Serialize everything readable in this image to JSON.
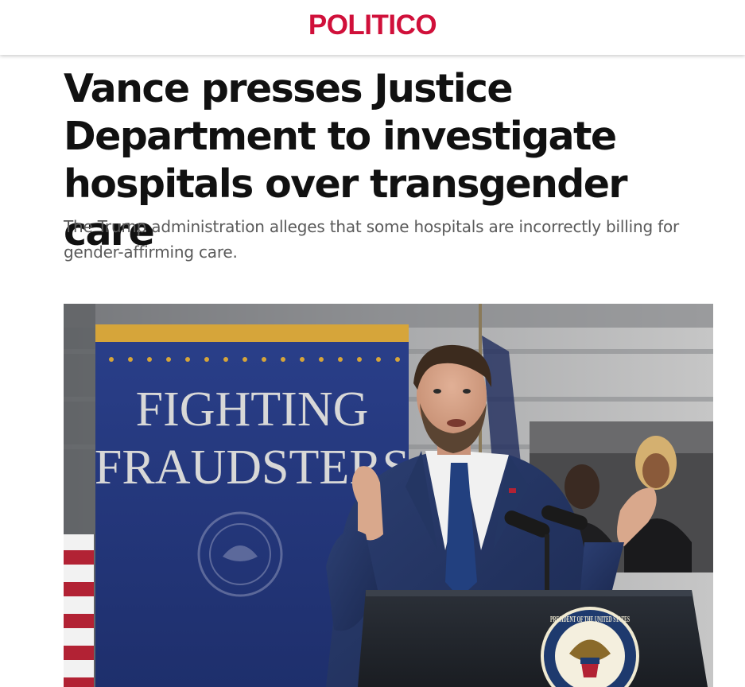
{
  "header": {
    "logo_text": "POLITICO",
    "brand_color": "#d0103a"
  },
  "article": {
    "headline": "Vance presses Justice Department to investigate hospitals over transgender care",
    "dek": "The Trump administration alleges that some hospitals are incorrectly billing for gender-affirming care."
  },
  "hero_image": {
    "banner_line1": "FIGHTING",
    "banner_line2": "FRAUDSTERS",
    "seal_text": "PRESIDENT OF THE UNITED STATES"
  },
  "icons": {
    "seal": "presidential-seal-icon"
  }
}
